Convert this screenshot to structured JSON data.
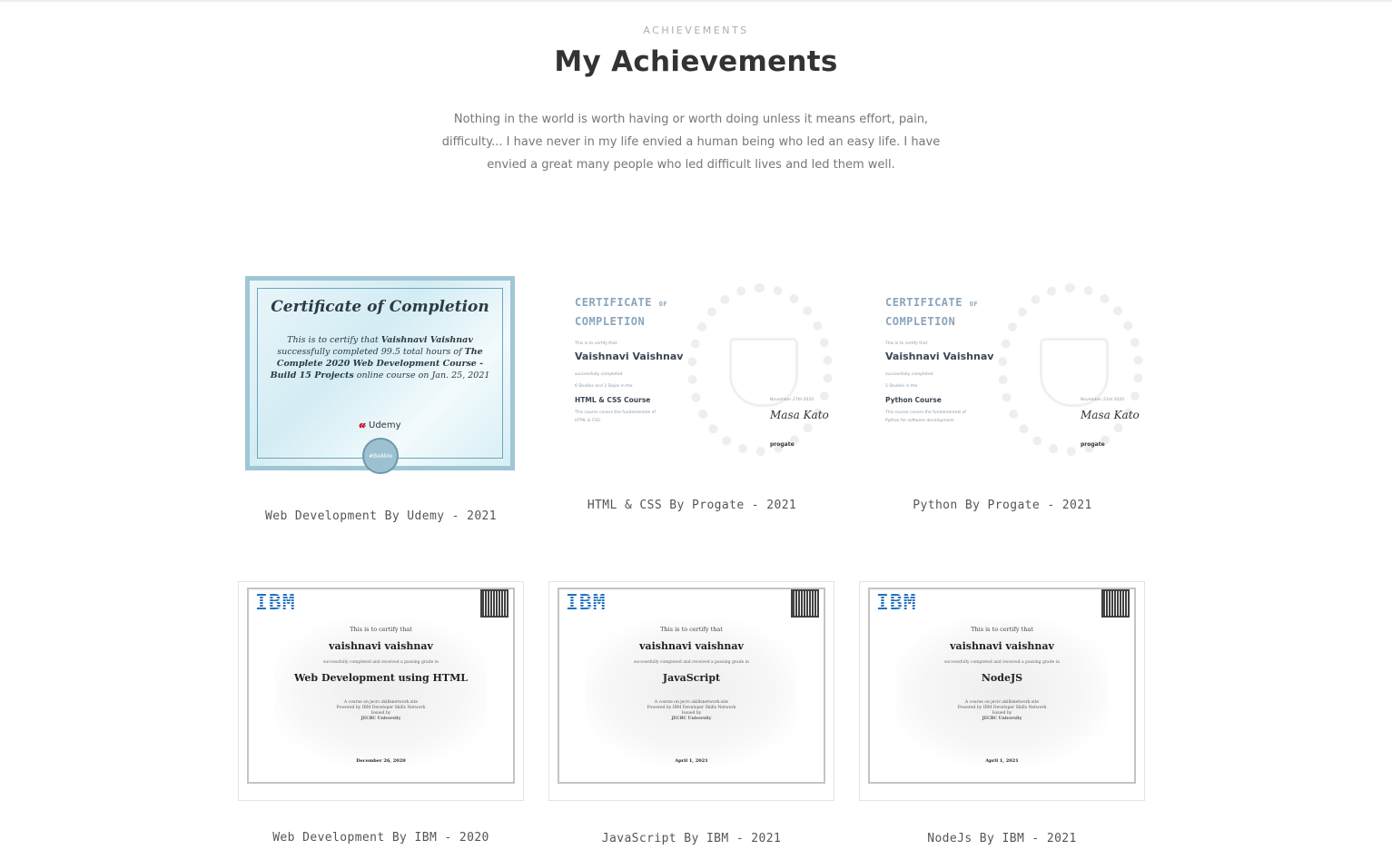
{
  "section": {
    "eyebrow": "ACHIEVEMENTS",
    "title": "My Achievements",
    "quote": "Nothing in the world is worth having or worth doing unless it means effort, pain, difficulty... I have never in my life envied a human being who led an easy life. I have envied a great many people who led difficult lives and led them well."
  },
  "cards": [
    {
      "caption": "Web Development By Udemy - 2021",
      "cert": {
        "title": "Certificate of Completion",
        "line1": "This is to certify that",
        "name": "Vaishnavi Vaishnav",
        "line2": "successfully completed 99.5 total hours of",
        "course": "The Complete 2020 Web Development Course - Build 15 Projects",
        "line3": "online course on Jan. 25, 2021",
        "org": "Udemy",
        "badge": "#BeAble"
      }
    },
    {
      "caption": "HTML & CSS By Progate - 2021",
      "cert": {
        "title1": "CERTIFICATE",
        "of": "OF",
        "title2": "COMPLETION",
        "certify": "This is to certify that",
        "name": "Vaishnavi Vaishnav",
        "completed": "successfully completed",
        "detail": "6 Studies and 2 Dojos in the",
        "course": "HTML & CSS Course",
        "covers": "This course covers the fundamentals of",
        "covers2": "HTML & CSS.",
        "date": "November 27th 2020",
        "sign": "Masa Kato",
        "logo": "progate"
      }
    },
    {
      "caption": "Python By Progate - 2021",
      "cert": {
        "title1": "CERTIFICATE",
        "of": "OF",
        "title2": "COMPLETION",
        "certify": "This is to certify that",
        "name": "Vaishnavi Vaishnav",
        "completed": "successfully completed",
        "detail": "5 Studies in the",
        "course": "Python Course",
        "covers": "This course covers the fundamentals of",
        "covers2": "Python for software development.",
        "date": "November 23rd 2020",
        "sign": "Masa Kato",
        "logo": "progate"
      }
    },
    {
      "caption": "Web Development By IBM - 2020",
      "cert": {
        "logo": "IBM",
        "certify": "This is to certify that",
        "name": "vaishnavi vaishnav",
        "completed": "successfully completed and received a passing grade in",
        "course": "Web Development using HTML",
        "provider": "A course on jecrc.skillsnetwork.site",
        "powered": "Powered by IBM Developer Skills Network",
        "issued": "Issued by",
        "issuer": "JECRC University",
        "date": "December 26, 2020"
      }
    },
    {
      "caption": "JavaScript By IBM - 2021",
      "cert": {
        "logo": "IBM",
        "certify": "This is to certify that",
        "name": "vaishnavi vaishnav",
        "completed": "successfully completed and received a passing grade in",
        "course": "JavaScript",
        "provider": "A course on jecrc.skillsnetwork.site",
        "powered": "Powered by IBM Developer Skills Network",
        "issued": "Issued by",
        "issuer": "JECRC University",
        "date": "April 1, 2021"
      }
    },
    {
      "caption": "NodeJs By IBM - 2021",
      "cert": {
        "logo": "IBM",
        "certify": "This is to certify that",
        "name": "vaishnavi vaishnav",
        "completed": "successfully completed and received a passing grade in",
        "course": "NodeJS",
        "provider": "A course on jecrc.skillsnetwork.site",
        "powered": "Powered by IBM Developer Skills Network",
        "issued": "Issued by",
        "issuer": "JECRC University",
        "date": "April 1, 2021"
      }
    }
  ]
}
